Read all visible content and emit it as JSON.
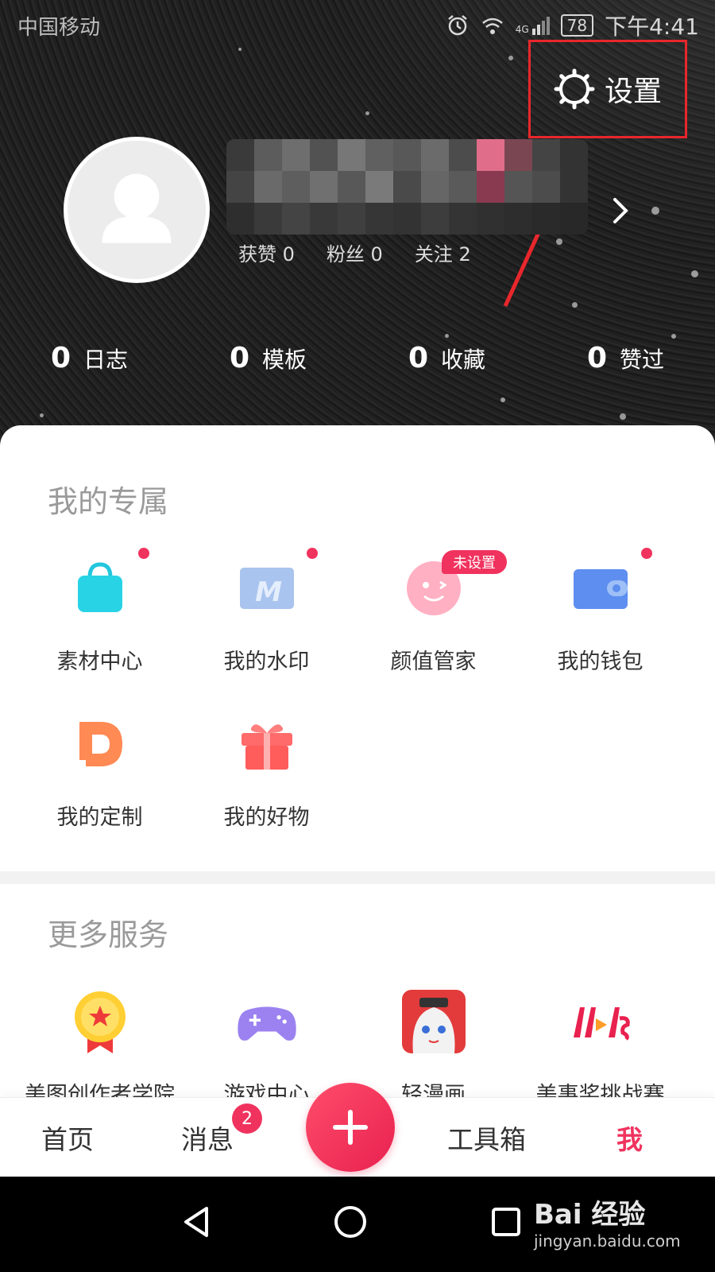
{
  "status_bar": {
    "carrier": "中国移动",
    "battery": "78",
    "time": "下午4:41",
    "signal_label": "4G"
  },
  "settings": {
    "label": "设置"
  },
  "profile": {
    "likes": "获赞 0",
    "fans": "粉丝 0",
    "following": "关注 2"
  },
  "counts": [
    {
      "num": "0",
      "label": "日志"
    },
    {
      "num": "0",
      "label": "模板"
    },
    {
      "num": "0",
      "label": "收藏"
    },
    {
      "num": "0",
      "label": "赞过"
    }
  ],
  "exclusive": {
    "title": "我的专属",
    "items": [
      {
        "label": "素材中心",
        "icon": "shopping-bag-icon"
      },
      {
        "label": "我的水印",
        "icon": "watermark-icon"
      },
      {
        "label": "颜值管家",
        "icon": "face-icon",
        "badge": "未设置"
      },
      {
        "label": "我的钱包",
        "icon": "wallet-icon"
      },
      {
        "label": "我的定制",
        "icon": "custom-d-icon"
      },
      {
        "label": "我的好物",
        "icon": "gift-icon"
      }
    ]
  },
  "services": {
    "title": "更多服务",
    "items": [
      {
        "label": "美图创作者学院",
        "icon": "medal-icon"
      },
      {
        "label": "游戏中心",
        "icon": "gamepad-icon"
      },
      {
        "label": "轻漫画",
        "icon": "comic-icon"
      },
      {
        "label": "美事奖挑战赛",
        "icon": "challenge-icon"
      }
    ]
  },
  "bottom_nav": {
    "home": "首页",
    "messages": "消息",
    "message_badge": "2",
    "toolbox": "工具箱",
    "me": "我"
  },
  "watermark": {
    "top": "Bai 经验",
    "bottom": "jingyan.baidu.com"
  },
  "colors": {
    "accent": "#f0335e",
    "annotation_red": "#e8272c"
  }
}
